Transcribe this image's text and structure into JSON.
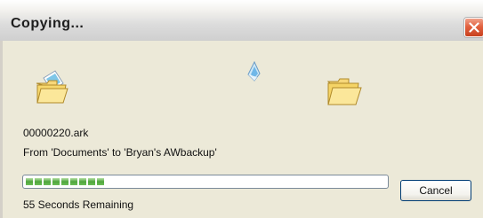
{
  "window": {
    "title": "Copying..."
  },
  "copy": {
    "file_name": "00000220.ark",
    "from_to": "From 'Documents' to 'Bryan's AWbackup'",
    "time_remaining": "55 Seconds Remaining"
  },
  "progress": {
    "fraction": 0.27,
    "filled_blocks": 9
  },
  "buttons": {
    "cancel_label": "Cancel"
  },
  "icons": {
    "source": "folder-icon",
    "flying": "document-icon",
    "destination": "folder-icon",
    "close": "close-icon"
  },
  "colors": {
    "progress_fill": "#4fa53c",
    "close_button": "#e2613f",
    "dialog_background": "#ece9d8"
  }
}
